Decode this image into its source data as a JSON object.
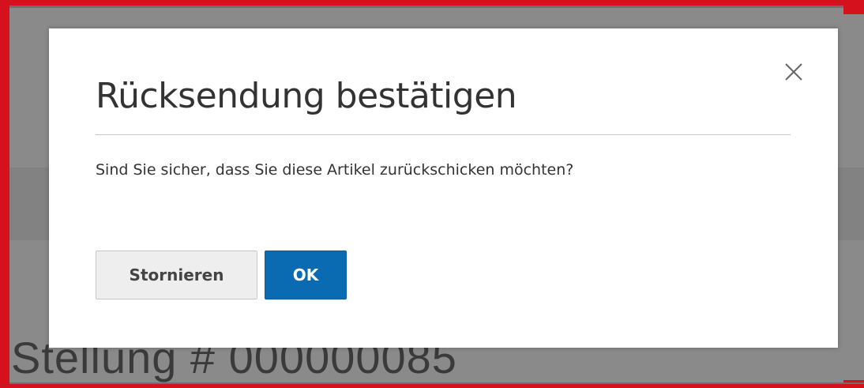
{
  "background": {
    "order_title": "Stellung # 000000085"
  },
  "modal": {
    "title": "Rücksendung bestätigen",
    "message": "Sind Sie sicher, dass Sie diese Artikel zurückschicken möchten?",
    "close_icon": "close-icon",
    "buttons": {
      "cancel_label": "Stornieren",
      "ok_label": "OK"
    }
  },
  "colors": {
    "accent": "#d4111d",
    "primary_button": "#0a6ab2",
    "overlay": "#8a8a8a"
  }
}
